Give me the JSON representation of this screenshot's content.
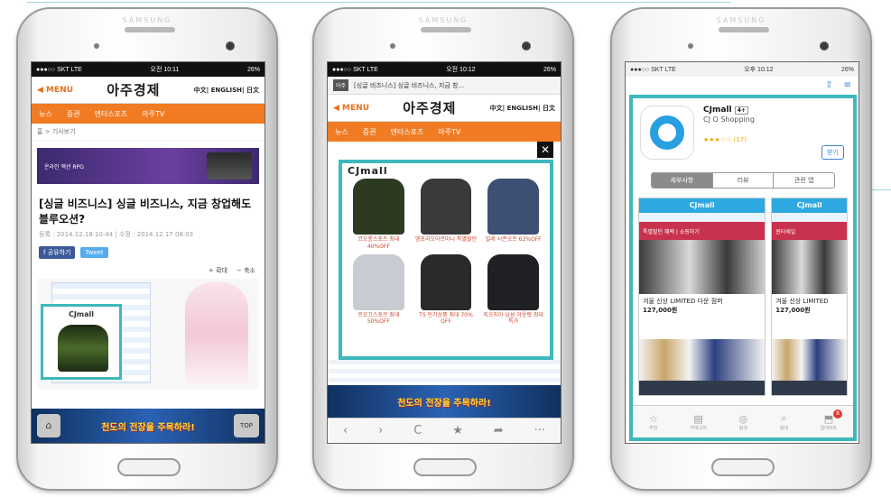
{
  "brand": "SAMSUNG",
  "phone1": {
    "status": {
      "carrier": "●●●○○ SKT  LTE",
      "time": "오전 10:11",
      "battery": "26%"
    },
    "header": {
      "menu": "◀ MENU",
      "logo": "아주경제",
      "lang": "中文| ENGLISH| 日文"
    },
    "nav": [
      "뉴스",
      "증권",
      "엔터스포츠",
      "아주TV"
    ],
    "breadcrumb": "홈 > 기사보기",
    "headline": "[싱글 비즈니스] 싱글 비즈니스, 지금 창업해도 블루오션?",
    "meta": "등록 : 2014.12.18 10:44 | 수정 : 2014.12.17 08:03",
    "share": {
      "facebook": "f 공유하기",
      "twitter": "Tweet"
    },
    "zoom": {
      "in": "+ 확대",
      "out": "− 축소"
    },
    "inset_ad_logo": "CJmall",
    "banner_text": "온라인 액션 RPG",
    "game_text": "천도의 전장을 주목하라!",
    "top_label": "TOP"
  },
  "phone2": {
    "status": {
      "carrier": "●●●○○ SKT  LTE",
      "time": "오전 10:12",
      "battery": "26%"
    },
    "tab_title": "[싱글 비즈니스] 싱글 비즈니스, 지금 창...",
    "tab_logo": "아주",
    "header": {
      "menu": "◀ MENU",
      "logo": "아주경제",
      "lang": "中文| ENGLISH| 日文"
    },
    "nav": [
      "뉴스",
      "증권",
      "엔터스포츠",
      "아주TV"
    ],
    "overlay_logo": "CJmall",
    "close": "✕",
    "products": [
      {
        "caption": "코오롱스포츠 최대40%OFF",
        "color": "#2c3a22"
      },
      {
        "caption": "엠포리오아르마니 특별할인",
        "color": "#3a3a3a"
      },
      {
        "caption": "밀레 시즌오프 62%OFF",
        "color": "#3d4f73"
      },
      {
        "caption": "르꼬끄스포르 최대50%OFF",
        "color": "#c8ccd2"
      },
      {
        "caption": "TS 인기상품 최대 70% OFF",
        "color": "#2a2a2a"
      },
      {
        "caption": "지오지아 남성 아웃렛 최대특가",
        "color": "#1f2024"
      }
    ],
    "game_text": "천도의 전장을 주목하라!",
    "browser_bar": [
      "‹",
      "›",
      "C",
      "★",
      "➦",
      "···"
    ]
  },
  "phone3": {
    "status": {
      "carrier": "●●●○○ SKT  LTE",
      "time": "오후 10:12",
      "battery": "26%"
    },
    "app": {
      "name": "CJmall",
      "age": "4+",
      "developer": "CJ O Shopping",
      "rating": "★★★☆☆ (17)",
      "get": "받기"
    },
    "segments": [
      "세부사항",
      "리뷰",
      "관련 앱"
    ],
    "shots": [
      {
        "logo": "CJmall",
        "promo": "특별할인 혜택 | 쇼핑하기",
        "price": "127,000원",
        "item": "겨울 신상 LIMITED 다운 점퍼"
      },
      {
        "logo": "CJmall",
        "promo": "윈터세일",
        "price": "127,000원",
        "item": "겨울 신상 LIMITED"
      }
    ],
    "tabbar": [
      {
        "icon": "☆",
        "label": "추천"
      },
      {
        "icon": "▤",
        "label": "카테고리"
      },
      {
        "icon": "◎",
        "label": "탐색"
      },
      {
        "icon": "⌕",
        "label": "검색"
      },
      {
        "icon": "⬒",
        "label": "업데이트",
        "badge": "8"
      }
    ]
  }
}
